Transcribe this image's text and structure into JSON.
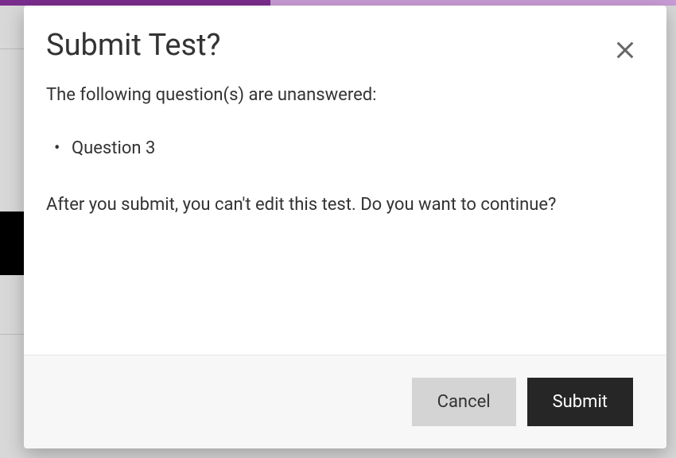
{
  "modal": {
    "title": "Submit Test?",
    "subheading": "The following question(s) are unanswered:",
    "unanswered": [
      "Question 3"
    ],
    "warning": "After you submit, you can't edit this test. Do you want to continue?",
    "cancel_label": "Cancel",
    "submit_label": "Submit"
  }
}
